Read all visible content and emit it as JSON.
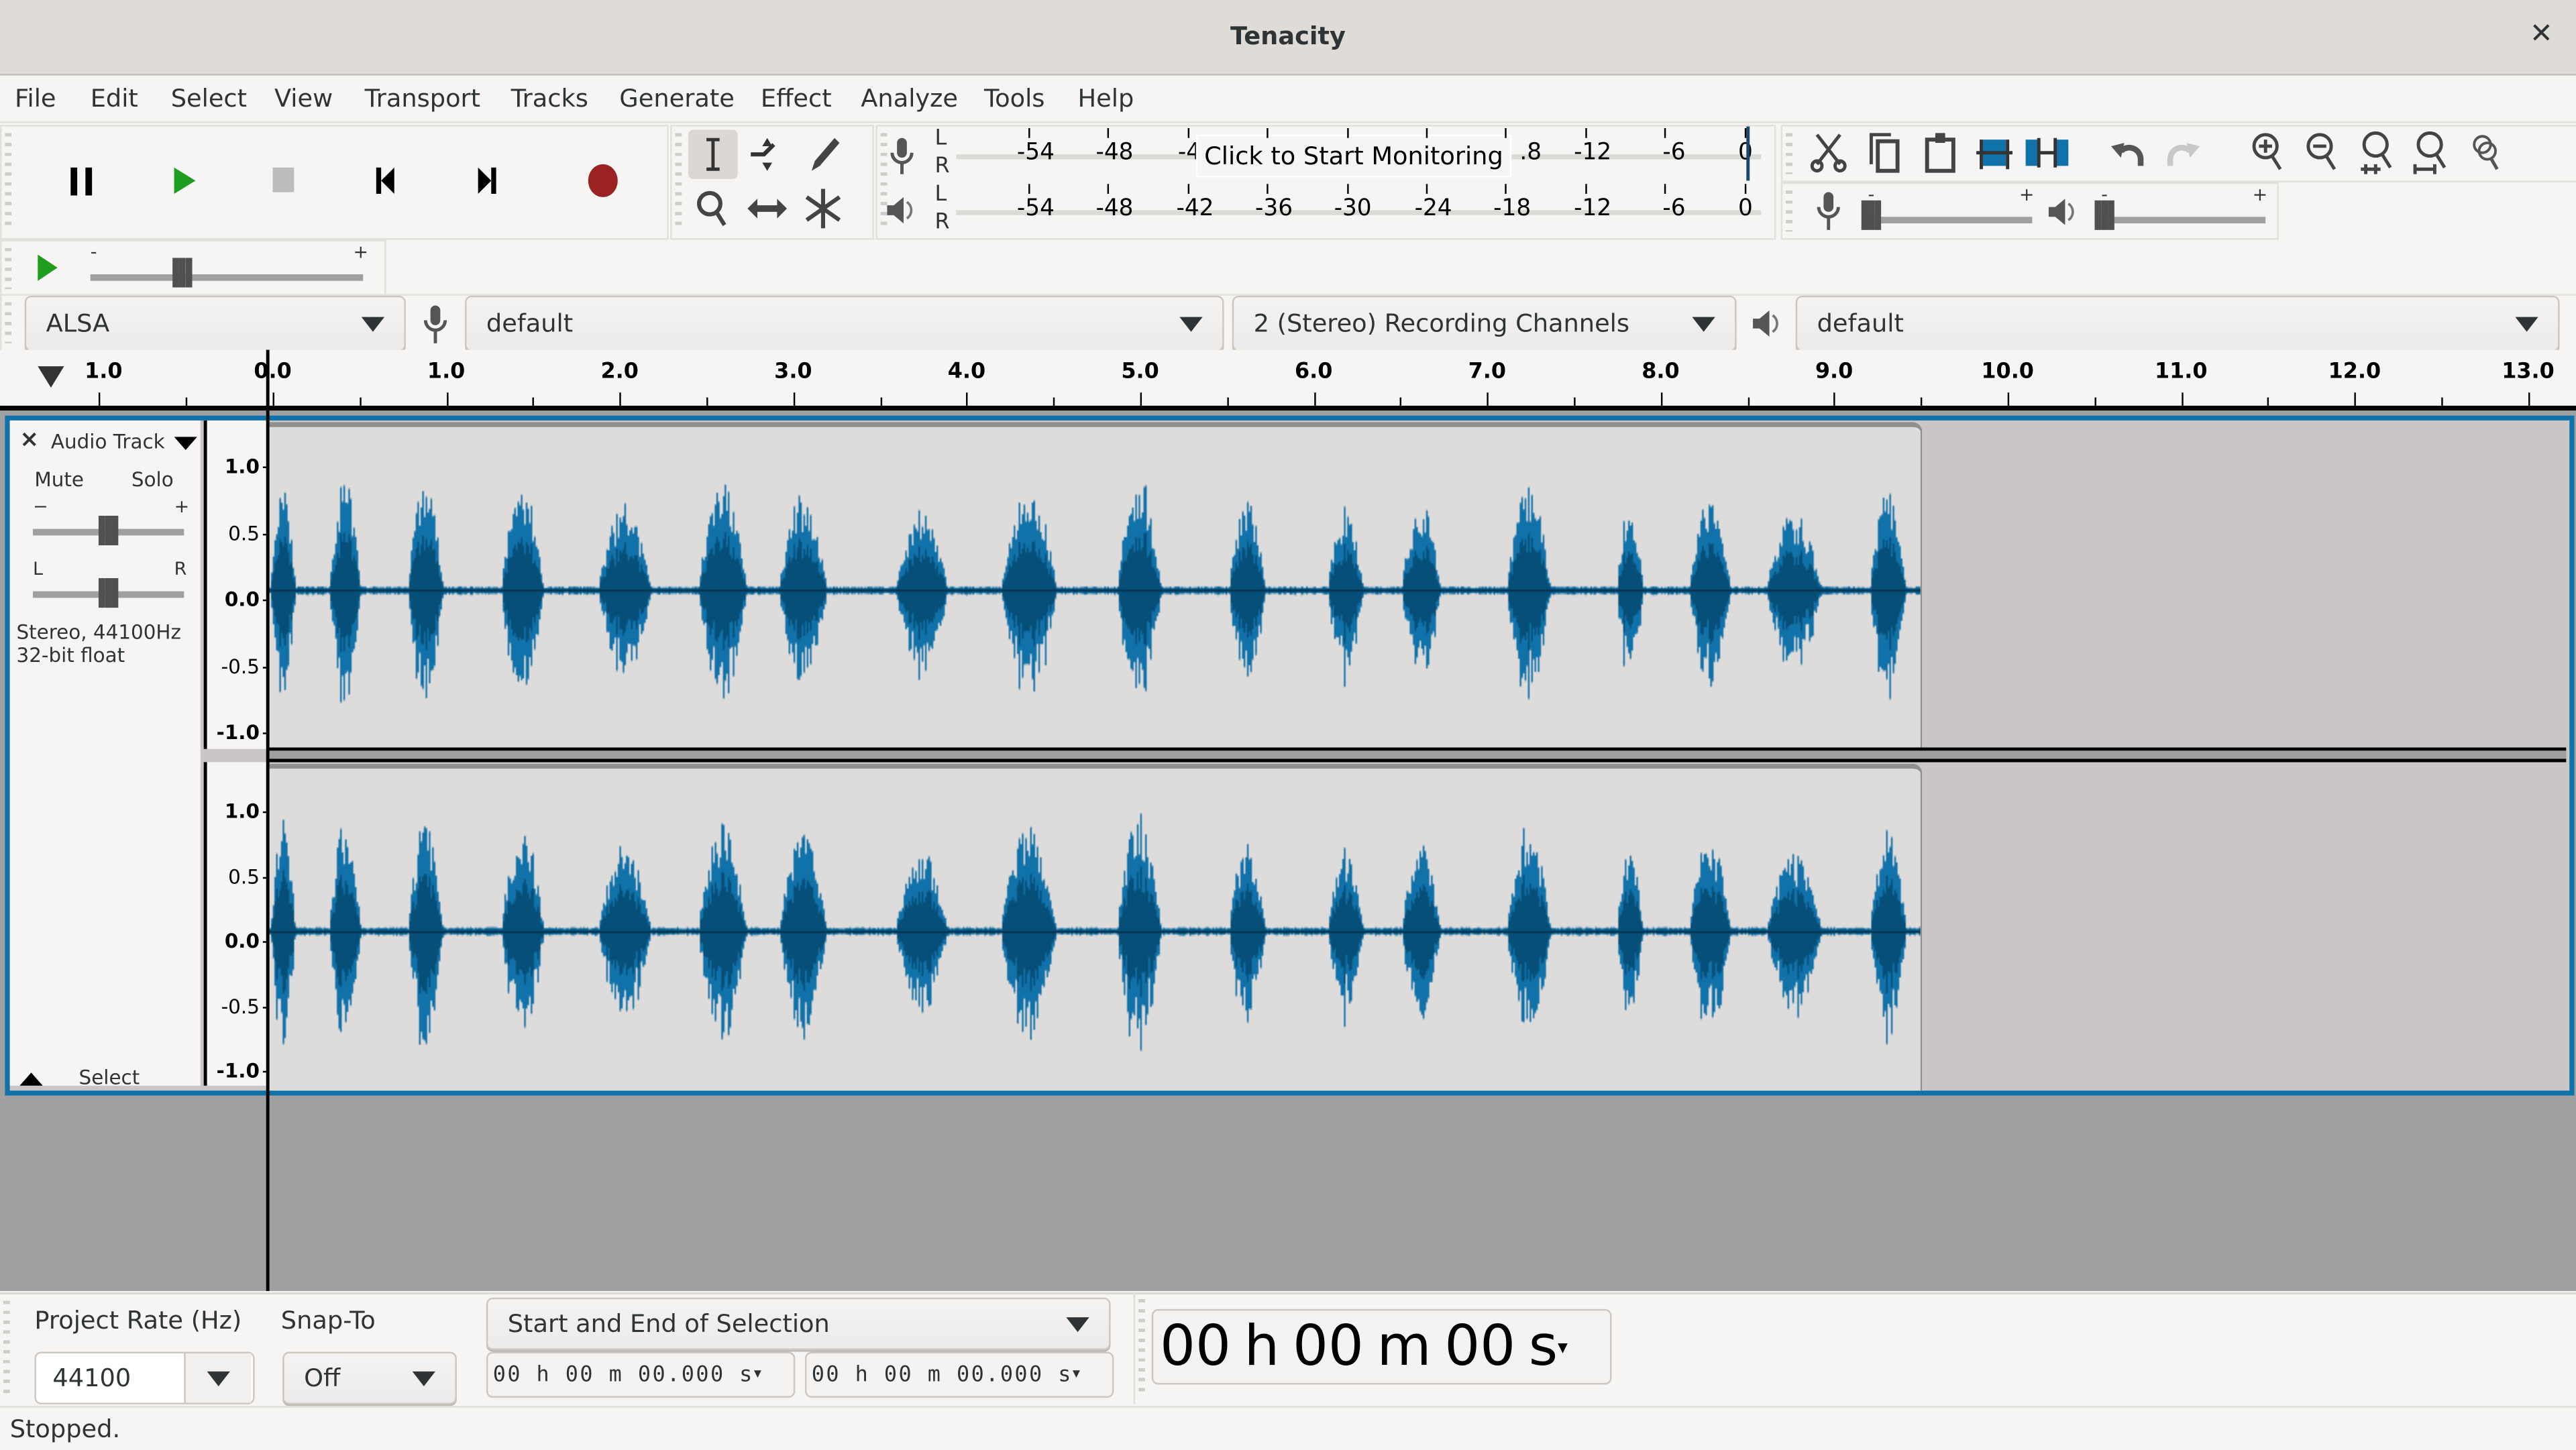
{
  "window": {
    "title": "Tenacity",
    "close_glyph": "✕"
  },
  "menu": [
    "File",
    "Edit",
    "Select",
    "View",
    "Transport",
    "Tracks",
    "Generate",
    "Effect",
    "Analyze",
    "Tools",
    "Help"
  ],
  "transport": {
    "buttons": [
      {
        "name": "pause-button",
        "icon": "pause-icon"
      },
      {
        "name": "play-button",
        "icon": "play-icon"
      },
      {
        "name": "stop-button",
        "icon": "stop-icon"
      },
      {
        "name": "skip-to-start-button",
        "icon": "skip-start-icon"
      },
      {
        "name": "skip-to-end-button",
        "icon": "skip-end-icon"
      },
      {
        "name": "record-button",
        "icon": "record-icon"
      }
    ]
  },
  "tools": [
    "selection-tool",
    "envelope-tool",
    "draw-tool",
    "zoom-tool",
    "time-shift-tool",
    "multi-tool"
  ],
  "meters": {
    "record": {
      "channels": [
        "L",
        "R"
      ],
      "scale": [
        "-54",
        "-48",
        "-4",
        "",
        "",
        "",
        ".8",
        "-12",
        "-6",
        "0"
      ],
      "overlay": "Click to Start Monitoring"
    },
    "playback": {
      "channels": [
        "L",
        "R"
      ],
      "scale": [
        "-54",
        "-48",
        "-42",
        "-36",
        "-30",
        "-24",
        "-18",
        "-12",
        "-6",
        "0"
      ]
    }
  },
  "edit_tools": [
    "cut",
    "copy",
    "paste",
    "trim-audio",
    "silence-audio",
    "undo",
    "redo",
    "zoom-in",
    "zoom-out",
    "fit-selection",
    "fit-project",
    "zoom-toggle"
  ],
  "mixer": {
    "record_volume_min": "-",
    "record_volume_max": "+",
    "playback_volume_min": "-",
    "playback_volume_max": "+",
    "record_level": 0.0,
    "playback_level": 0.0
  },
  "play_at_speed": {
    "min": "-",
    "max": "+",
    "level": 0.33
  },
  "device": {
    "host": "ALSA",
    "recording_device": "default",
    "channels": "2 (Stereo) Recording Channels",
    "playback_device": "default"
  },
  "ruler": {
    "labels": [
      "1.0",
      "0.0",
      "1.0",
      "2.0",
      "3.0",
      "4.0",
      "5.0",
      "6.0",
      "7.0",
      "8.0",
      "9.0",
      "10.0",
      "11.0",
      "12.0",
      "13.0"
    ]
  },
  "track": {
    "name": "Audio Track",
    "mute": "Mute",
    "solo": "Solo",
    "gain_min": "−",
    "gain_max": "+",
    "pan_left": "L",
    "pan_right": "R",
    "info_line1": "Stereo, 44100Hz",
    "info_line2": "32-bit float",
    "select": "Select",
    "gain_level": 0.5,
    "pan_level": 0.5,
    "vscale": [
      "1.0",
      "0.5",
      "0.0",
      "-0.5",
      "-1.0"
    ],
    "waveform_colors": {
      "sample": "#1172aa",
      "rms": "#064f78",
      "background": "#dedcda"
    }
  },
  "selection_toolbar": {
    "project_rate_label": "Project Rate (Hz)",
    "project_rate": "44100",
    "snap_to_label": "Snap-To",
    "snap_to": "Off",
    "selection_mode": "Start and End of Selection",
    "start_time": "00 h 00 m 00.000 s",
    "end_time": "00 h 00 m 00.000 s"
  },
  "time_display": {
    "hh": "00",
    "h": "h",
    "mm": "00",
    "m": "m",
    "ss": "00",
    "s": "s"
  },
  "status": "Stopped."
}
